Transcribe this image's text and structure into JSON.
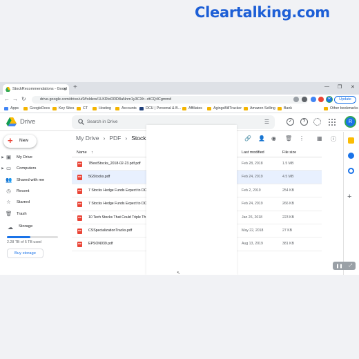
{
  "brand": "Cleartalking.com",
  "browser": {
    "tab_title": "StockRecommendations - Googl",
    "url": "drive.google.com/drive/u/0/folders/1LKRtcDRD8aNnm1y3CXh--ritCQ4Cgmmd",
    "update_label": "Update",
    "profile_initial": "R",
    "bookmarks": [
      "Apps",
      "GoogleDocs",
      "Key Sites",
      "CT",
      "Hosting",
      "Accounts",
      "DCU | Personal & B...",
      "Affiliates",
      "AgingsBillTracker",
      "Amazon Selling",
      "Bank"
    ],
    "other_bookmarks": "Other bookmarks"
  },
  "drive": {
    "app_name": "Drive",
    "search_placeholder": "Search in Drive",
    "new_label": "New",
    "avatar_initial": "R",
    "nav": [
      {
        "label": "My Drive",
        "icon": "my-drive-icon",
        "caret": true
      },
      {
        "label": "Computers",
        "icon": "computers-icon",
        "caret": true
      },
      {
        "label": "Shared with me",
        "icon": "shared-icon",
        "caret": false
      },
      {
        "label": "Recent",
        "icon": "clock-icon",
        "caret": false
      },
      {
        "label": "Starred",
        "icon": "star-icon",
        "caret": false
      },
      {
        "label": "Trash",
        "icon": "trash-icon",
        "caret": false
      }
    ],
    "storage": {
      "label": "Storage",
      "used_text": "2.28 TB of 5 TB used",
      "used_fraction": 0.456,
      "buy_label": "Buy storage"
    },
    "breadcrumb": [
      "My Drive",
      "PDF",
      "StockRe"
    ],
    "columns": {
      "name": "Name",
      "modified": "Last modified",
      "size": "File size"
    },
    "files": [
      {
        "name": "7BestStocks_2018-02-23.pdf.pdf",
        "modified": "Feb 28, 2018",
        "size": "1.5 MB",
        "selected": false
      },
      {
        "name": "5GStocks.pdf",
        "modified": "Feb 24, 2019",
        "size": "4.5 MB",
        "selected": true
      },
      {
        "name": "7 Stocks Hedge Funds Expect to DO",
        "modified": "Feb 2, 2019",
        "size": "254 KB",
        "selected": false
      },
      {
        "name": "7 Stocks Hedge Funds Expect to DO",
        "modified": "Feb 24, 2019",
        "size": "266 KB",
        "selected": false
      },
      {
        "name": "10 Tech Stocks That Could Triple Th",
        "modified": "Jan 26, 2018",
        "size": "223 KB",
        "selected": false
      },
      {
        "name": "CSSpecializationTracks.pdf",
        "modified": "May 22, 2018",
        "size": "27 KB",
        "selected": false
      },
      {
        "name": "EPSON039.pdf",
        "modified": "Aug 13, 2019",
        "size": "381 KB",
        "selected": false
      }
    ]
  }
}
